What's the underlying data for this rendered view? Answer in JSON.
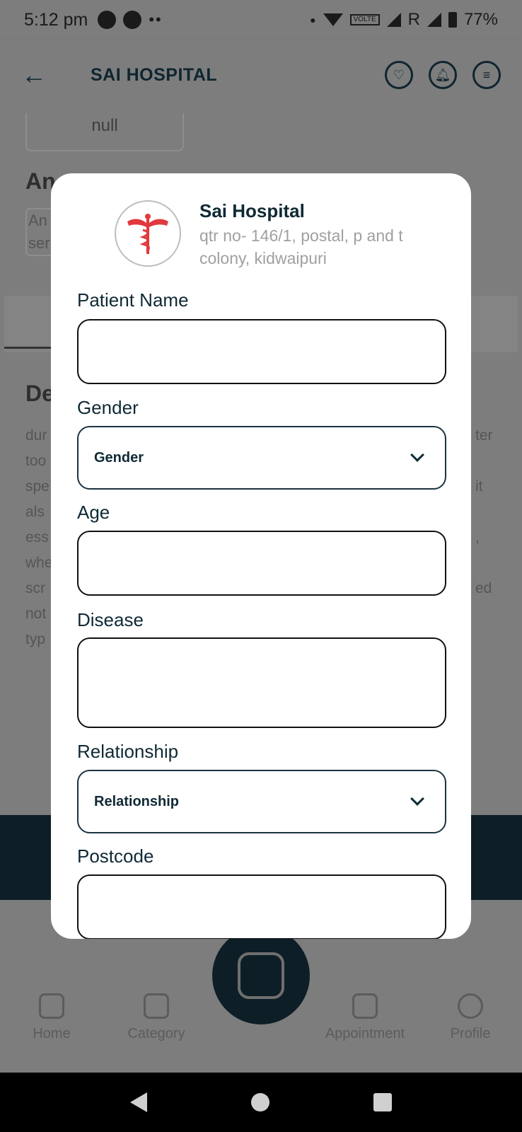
{
  "status_bar": {
    "time": "5:12 pm",
    "dots": "••",
    "volte": "VOLTE",
    "r": "R",
    "battery": "77%"
  },
  "app_bar": {
    "title": "SAI HOSPITAL"
  },
  "background": {
    "box_value": "null",
    "heading1": "An",
    "textbox_lines": [
      "An",
      "ser"
    ],
    "heading2": "De",
    "desc_lines": [
      "dur",
      "too",
      "spe",
      "als",
      "ess",
      "whe",
      "scr",
      "not",
      "typ"
    ],
    "right_lines": [
      "ter",
      "",
      "it",
      "",
      ",",
      "",
      "ed"
    ]
  },
  "modal": {
    "hospital_name": "Sai Hospital",
    "hospital_address": "qtr no- 146/1, postal, p and t colony, kidwaipuri",
    "fields": {
      "patient_name_label": "Patient Name",
      "gender_label": "Gender",
      "gender_value": "Gender",
      "age_label": "Age",
      "disease_label": "Disease",
      "relationship_label": "Relationship",
      "relationship_value": "Relationship",
      "postcode_label": "Postcode"
    }
  },
  "bottom_nav": {
    "home": "Home",
    "category": "Category",
    "appointment": "Appointment",
    "profile": "Profile"
  },
  "colors": {
    "primary": "#0f2a35",
    "overlay": "#7d7d7d",
    "accent_red": "#e03a3e"
  }
}
